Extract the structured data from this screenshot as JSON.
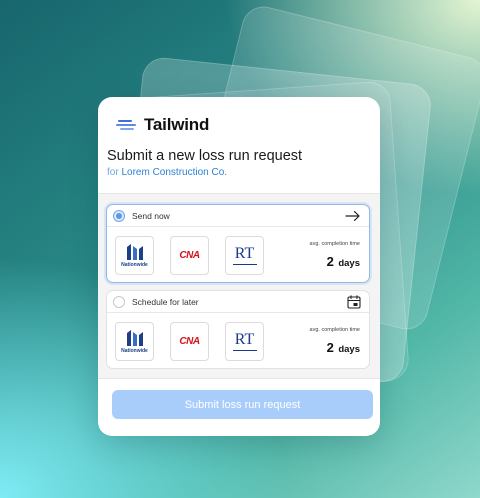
{
  "brand": {
    "name": "Tailwind",
    "accent": "#3c6fd8"
  },
  "form": {
    "title": "Submit a new loss run request",
    "subtitle_prefix": "for",
    "subtitle_company": "Lorem Construction Co.",
    "submit_label": "Submit loss run request"
  },
  "options": [
    {
      "label": "Send now",
      "selected": true,
      "icon": "arrow-right-icon",
      "carriers": [
        "Nationwide",
        "CNA",
        "RT"
      ],
      "eta_label": "avg. completion time",
      "eta_number": "2",
      "eta_unit": "days"
    },
    {
      "label": "Schedule for later",
      "selected": false,
      "icon": "calendar-icon",
      "carriers": [
        "Nationwide",
        "CNA",
        "RT"
      ],
      "eta_label": "avg. completion time",
      "eta_number": "2",
      "eta_unit": "days"
    }
  ],
  "colors": {
    "selected_border": "#8fb9ec",
    "submit_bg": "#a8cdfb",
    "subtitle": "#2f7fd6",
    "cna": "#d6121a",
    "nationwide": "#1c3f87"
  }
}
